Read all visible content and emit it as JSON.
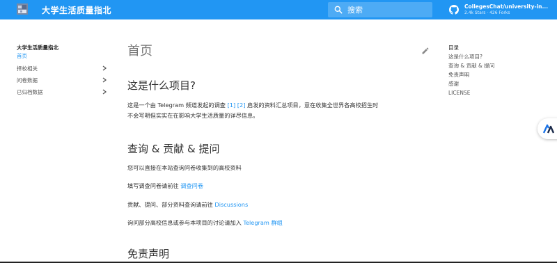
{
  "colors": {
    "primary": "#2196f3",
    "link": "#2196f3"
  },
  "header": {
    "site_title": "大学生活质量指北",
    "search_placeholder": "搜索",
    "repo_name": "CollegesChat/university-in...",
    "repo_stats": "2.4k Stars · 426 Forks"
  },
  "sidebar": {
    "title": "大学生活质量指北",
    "items": [
      {
        "label": "首页",
        "active": true
      },
      {
        "label": "择校相关",
        "icon": "chevron-right-icon"
      },
      {
        "label": "问卷数据",
        "icon": "chevron-right-icon"
      },
      {
        "label": "已归档数据",
        "icon": "chevron-right-icon"
      }
    ]
  },
  "main": {
    "page_title": "首页",
    "sections": [
      {
        "heading": "这是什么项目?",
        "para": {
          "before": "这是一个由 Telegram 频道发起的调查 ",
          "ref1": "[1]",
          "ref2": "[2]",
          "after": " 启发的资料汇总项目，意在收集全世界各高校招生时",
          "line2": "不会写明但实实在在影响大学生活质量的详尽信息。"
        }
      },
      {
        "heading": "查询 & 贡献 & 提问",
        "lines": [
          {
            "text": "您可以直接在本站查询问卷收集到的高校资料"
          },
          {
            "text": "填写调查问卷请前往 ",
            "link": "调查问卷"
          },
          {
            "text": "贡献、提问、部分资料查询请前往 ",
            "link": "Discussions"
          },
          {
            "text": "询问部分高校信息或参与本项目的讨论请加入 ",
            "link": "Telegram 群组"
          }
        ]
      },
      {
        "heading": "免责声明"
      }
    ]
  },
  "toc": {
    "title": "目录",
    "items": [
      "这是什么项目?",
      "查询 & 贡献 & 提问",
      "免责声明",
      "感谢",
      "LICENSE"
    ]
  }
}
